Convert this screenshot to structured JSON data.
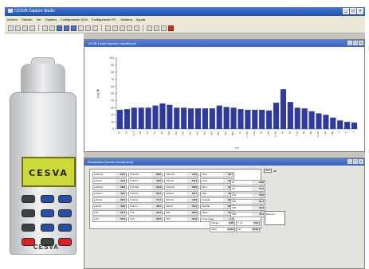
{
  "app": {
    "title": "CESVA Capture Studio"
  },
  "menu": [
    "Archivo",
    "Edición",
    "Ver",
    "Captura",
    "Configuración SLM",
    "Configuración PC",
    "Ventana",
    "Ayuda"
  ],
  "device": {
    "screen_brand": "CESVA",
    "logo": "CESVA"
  },
  "chart_window": {
    "title": "1/3 dB Leq(t) espectro amplificado"
  },
  "table_window": {
    "title": "Resultados (evento actualizado)"
  },
  "chart_data": {
    "type": "bar",
    "ylabel": "Leq dB",
    "xlabel": "Hz",
    "ylim": [
      0,
      100
    ],
    "y_ticks": [
      0,
      10,
      20,
      30,
      40,
      50,
      60,
      70,
      80,
      90,
      100
    ],
    "categories": [
      "20",
      "25",
      "31.5",
      "40",
      "50",
      "63",
      "80",
      "100",
      "125",
      "160",
      "200",
      "250",
      "315",
      "400",
      "500",
      "630",
      "800",
      "1k",
      "1.25k",
      "1.6k",
      "2k",
      "2.5k",
      "3.15k",
      "4k",
      "5k",
      "6.3k",
      "8k",
      "10k",
      "12.5k",
      "16k",
      "20k",
      "A",
      "C",
      "Z"
    ],
    "values": [
      27,
      28,
      30,
      30,
      30,
      33,
      36,
      34,
      30,
      30,
      29,
      29,
      29,
      29,
      33,
      31,
      30,
      28,
      27,
      27,
      27,
      26,
      37,
      56,
      38,
      30,
      29,
      25,
      22,
      20,
      16,
      12,
      10,
      9
    ]
  },
  "results": {
    "cells": [
      {
        "label": "LAFmax",
        "value": "60.2"
      },
      {
        "label": "LCFmax",
        "value": "68.0"
      },
      {
        "label": "LZFmax",
        "value": "70.3"
      },
      {
        "label": "LAeq",
        "value": "52.7"
      },
      {
        "label": "LAFmin",
        "value": "41.6"
      },
      {
        "label": "LCFmin",
        "value": "49.9"
      },
      {
        "label": "LZFmin",
        "value": "52.4"
      },
      {
        "label": "LCeq",
        "value": "60.1"
      },
      {
        "label": "LASmax",
        "value": "58.8"
      },
      {
        "label": "LCSmax",
        "value": "66.3"
      },
      {
        "label": "LZSmax",
        "value": "68.9"
      },
      {
        "label": "LZeq",
        "value": "63.5"
      },
      {
        "label": "LASmin",
        "value": "43.0"
      },
      {
        "label": "LCSmin",
        "value": "51.2"
      },
      {
        "label": "LZSmin",
        "value": "53.7"
      },
      {
        "label": "LAE",
        "value": "78.4"
      },
      {
        "label": "LAImax",
        "value": "62.5"
      },
      {
        "label": "LCImax",
        "value": "70.1"
      },
      {
        "label": "LZImax",
        "value": "72.6"
      },
      {
        "label": "LCpeak",
        "value": "83.9"
      },
      {
        "label": "LAImin",
        "value": "40.8"
      },
      {
        "label": "LCImin",
        "value": "48.7"
      },
      {
        "label": "LZImin",
        "value": "51.0"
      },
      {
        "label": "LZpeak",
        "value": "85.2"
      },
      {
        "label": "LAF",
        "value": "51.3"
      },
      {
        "label": "LCF",
        "value": "59.4"
      },
      {
        "label": "LZF",
        "value": "62.2"
      },
      {
        "label": "LAIeq",
        "value": "55.0"
      },
      {
        "label": "LAS",
        "value": "50.9"
      },
      {
        "label": "LCS",
        "value": "58.7"
      },
      {
        "label": "LZS",
        "value": "61.8"
      },
      {
        "label": "LCeq-LAeq",
        "value": "7.4"
      }
    ],
    "side_cells": [
      {
        "label": "L1",
        "value": "59.8"
      },
      {
        "label": "L5",
        "value": "57.2"
      },
      {
        "label": "L10",
        "value": "55.6"
      },
      {
        "label": "L50",
        "value": "51.4"
      },
      {
        "label": "L90",
        "value": "46.3"
      },
      {
        "label": "L95",
        "value": "45.1"
      }
    ],
    "bottom_cells": [
      {
        "label": "Tiempo",
        "value": "0:05"
      },
      {
        "label": "T. int",
        "value": "0:01"
      },
      {
        "label": "Inicio",
        "value": "12:04"
      },
      {
        "label": "Fin",
        "value": "12:09"
      }
    ],
    "tag_label": "Hora",
    "tag_value": "dB",
    "side_box_text": "Evento 1"
  }
}
